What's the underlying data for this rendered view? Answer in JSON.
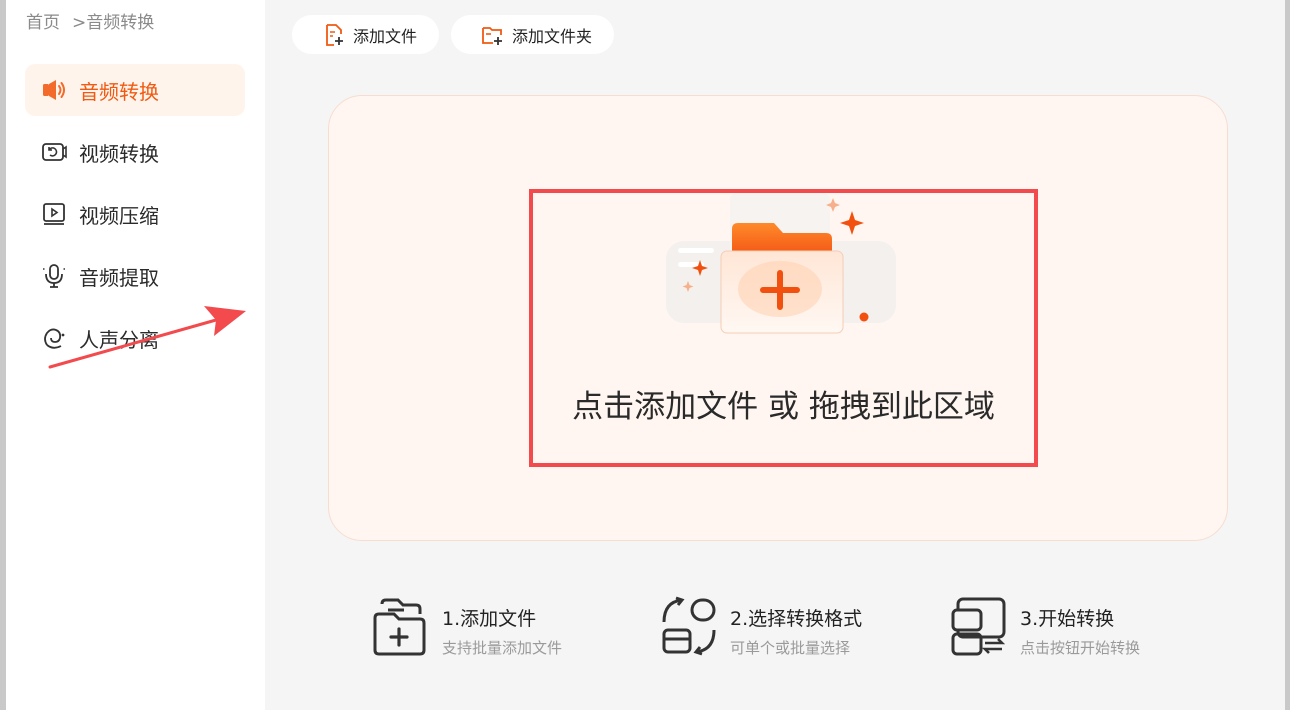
{
  "breadcrumb": {
    "home": "首页",
    "current": ">音频转换"
  },
  "sidebar": {
    "items": [
      {
        "label": "音频转换"
      },
      {
        "label": "视频转换"
      },
      {
        "label": "视频压缩"
      },
      {
        "label": "音频提取"
      },
      {
        "label": "人声分离"
      }
    ]
  },
  "toolbar": {
    "add_file": "添加文件",
    "add_folder": "添加文件夹"
  },
  "dropzone": {
    "text": "点击添加文件 或 拖拽到此区域"
  },
  "steps": [
    {
      "title": "1.添加文件",
      "subtitle": "支持批量添加文件"
    },
    {
      "title": "2.选择转换格式",
      "subtitle": "可单个或批量选择"
    },
    {
      "title": "3.开始转换",
      "subtitle": "点击按钮开始转换"
    }
  ],
  "colors": {
    "accent": "#f05a12",
    "highlight": "#f24a4d",
    "active_bg": "#fff4ec"
  },
  "icons": [
    "speaker-icon",
    "video-camera-icon",
    "video-compress-icon",
    "microphone-icon",
    "voice-separation-icon",
    "file-add-icon",
    "folder-add-icon"
  ]
}
